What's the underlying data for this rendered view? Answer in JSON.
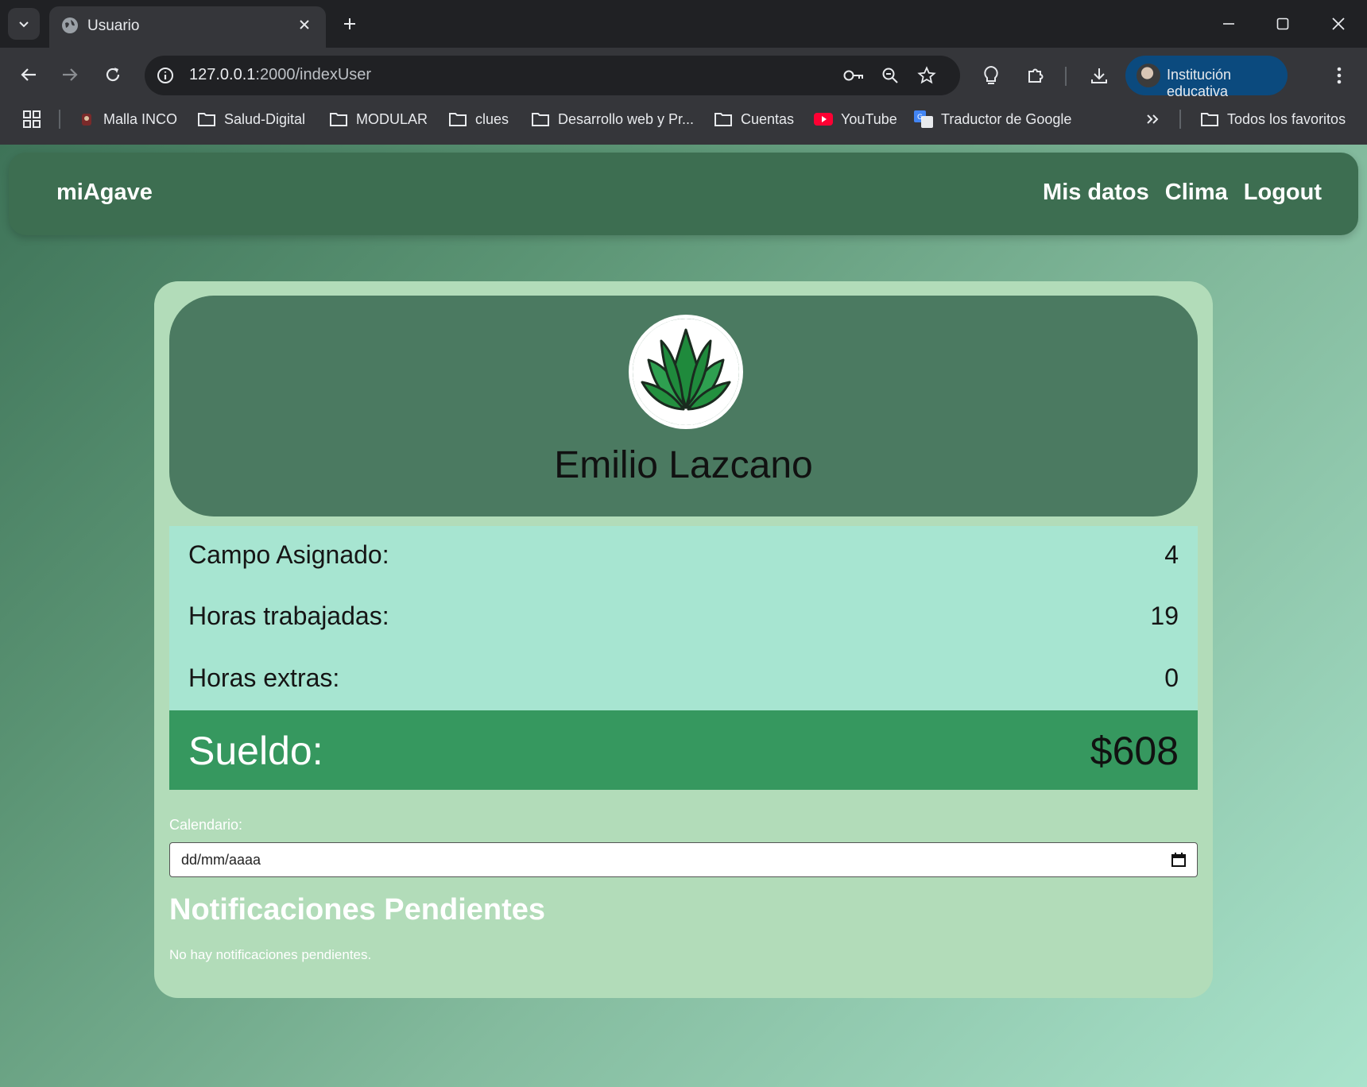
{
  "browser": {
    "tab_title": "Usuario",
    "url_host": "127.0.0.1",
    "url_path": ":2000/indexUser",
    "profile_label": "Institución educativa",
    "bookmarks": [
      {
        "label": "Malla INCO",
        "icon": "app-favicon-icon"
      },
      {
        "label": "Salud-Digital",
        "icon": "folder-icon"
      },
      {
        "label": "MODULAR",
        "icon": "folder-icon"
      },
      {
        "label": "clues",
        "icon": "folder-icon"
      },
      {
        "label": "Desarrollo web y Pr...",
        "icon": "folder-icon"
      },
      {
        "label": "Cuentas",
        "icon": "folder-icon"
      },
      {
        "label": "YouTube",
        "icon": "youtube-icon"
      },
      {
        "label": "Traductor de Google",
        "icon": "google-translate-icon"
      }
    ],
    "all_bookmarks_label": "Todos los favoritos"
  },
  "navbar": {
    "brand": "miAgave",
    "links": [
      "Mis datos",
      "Clima",
      "Logout"
    ]
  },
  "profile": {
    "name": "Emilio Lazcano",
    "logo_icon": "agave-logo-icon"
  },
  "stats": [
    {
      "label": "Campo Asignado:",
      "value": "4"
    },
    {
      "label": "Horas trabajadas:",
      "value": "19"
    },
    {
      "label": "Horas extras:",
      "value": "0"
    }
  ],
  "salary": {
    "label": "Sueldo:",
    "value": "$608"
  },
  "calendar": {
    "label": "Calendario:",
    "placeholder": "dd/mm/aaaa"
  },
  "notifications": {
    "title": "Notificaciones Pendientes",
    "empty_text": "No hay notificaciones pendientes."
  },
  "colors": {
    "navbar": "#3d6e51",
    "card": "#b2dcb9",
    "header_panel": "#4b7a61",
    "stats_bg": "#a7e5d1",
    "salary_bg": "#36985f"
  }
}
